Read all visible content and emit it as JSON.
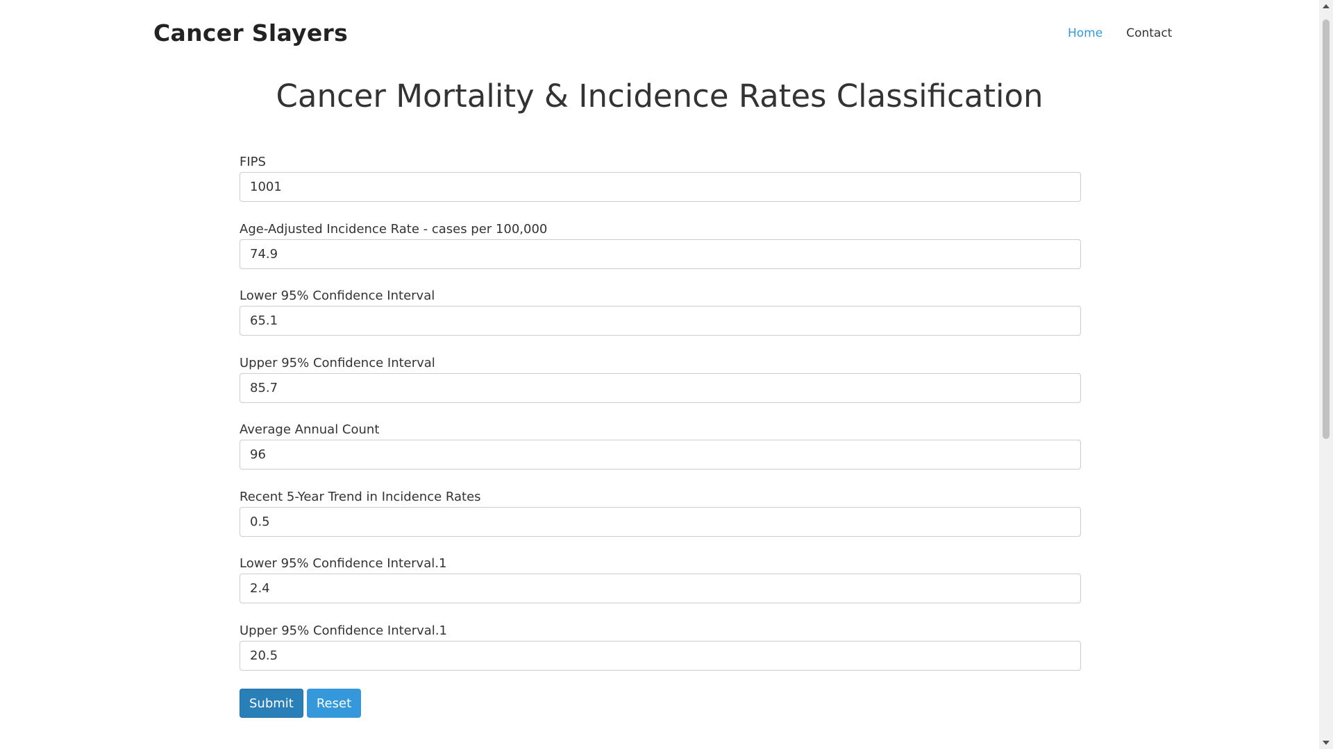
{
  "navbar": {
    "brand": "Cancer Slayers",
    "links": [
      {
        "label": "Home",
        "active": true
      },
      {
        "label": "Contact",
        "active": false
      }
    ]
  },
  "page": {
    "title": "Cancer Mortality & Incidence Rates Classification"
  },
  "form": {
    "fields": [
      {
        "label": "FIPS",
        "value": "1001"
      },
      {
        "label": "Age-Adjusted Incidence Rate - cases per 100,000",
        "value": "74.9"
      },
      {
        "label": "Lower 95% Confidence Interval",
        "value": "65.1"
      },
      {
        "label": "Upper 95% Confidence Interval",
        "value": "85.7"
      },
      {
        "label": "Average Annual Count",
        "value": "96"
      },
      {
        "label": "Recent 5-Year Trend in Incidence Rates",
        "value": "0.5"
      },
      {
        "label": "Lower 95% Confidence Interval.1",
        "value": "2.4"
      },
      {
        "label": "Upper 95% Confidence Interval.1",
        "value": "20.5"
      }
    ],
    "submit_label": "Submit",
    "reset_label": "Reset"
  },
  "colors": {
    "accent": "#3498db",
    "submit": "#2980b9",
    "text": "#333333"
  }
}
